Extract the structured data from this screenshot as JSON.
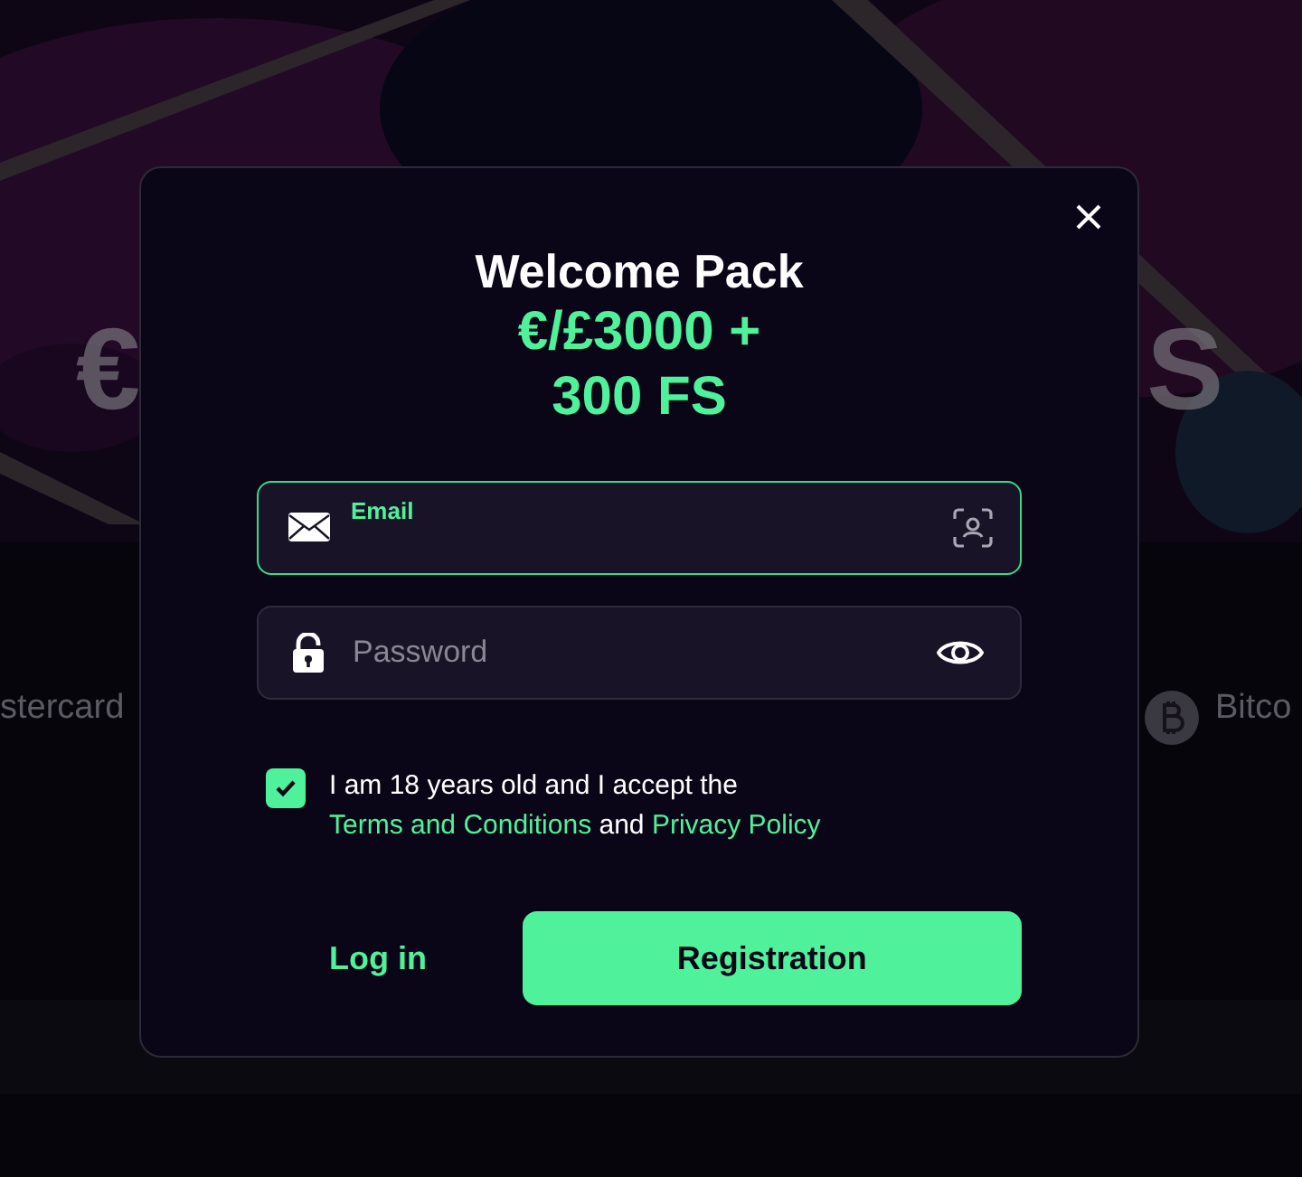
{
  "background": {
    "headline_start": "€",
    "headline_end": "S",
    "payment_methods": [
      {
        "label": "stercard",
        "kind": "card"
      },
      {
        "label": "Bitco",
        "kind": "crypto"
      }
    ]
  },
  "modal": {
    "title": "Welcome Pack",
    "offer": "€/£3000 + 300 FS",
    "email": {
      "label": "Email",
      "focused": true
    },
    "password": {
      "placeholder": "Password",
      "focused": false
    },
    "consent": {
      "checked": true,
      "parts": [
        {
          "kind": "text",
          "text": "I am 18 years old and I accept the"
        },
        {
          "kind": "link",
          "text": "Terms and Conditions"
        },
        {
          "kind": "text",
          "text": "and"
        },
        {
          "kind": "link",
          "text": "Privacy Policy"
        }
      ]
    },
    "login": "Log in",
    "register": "Registration"
  }
}
